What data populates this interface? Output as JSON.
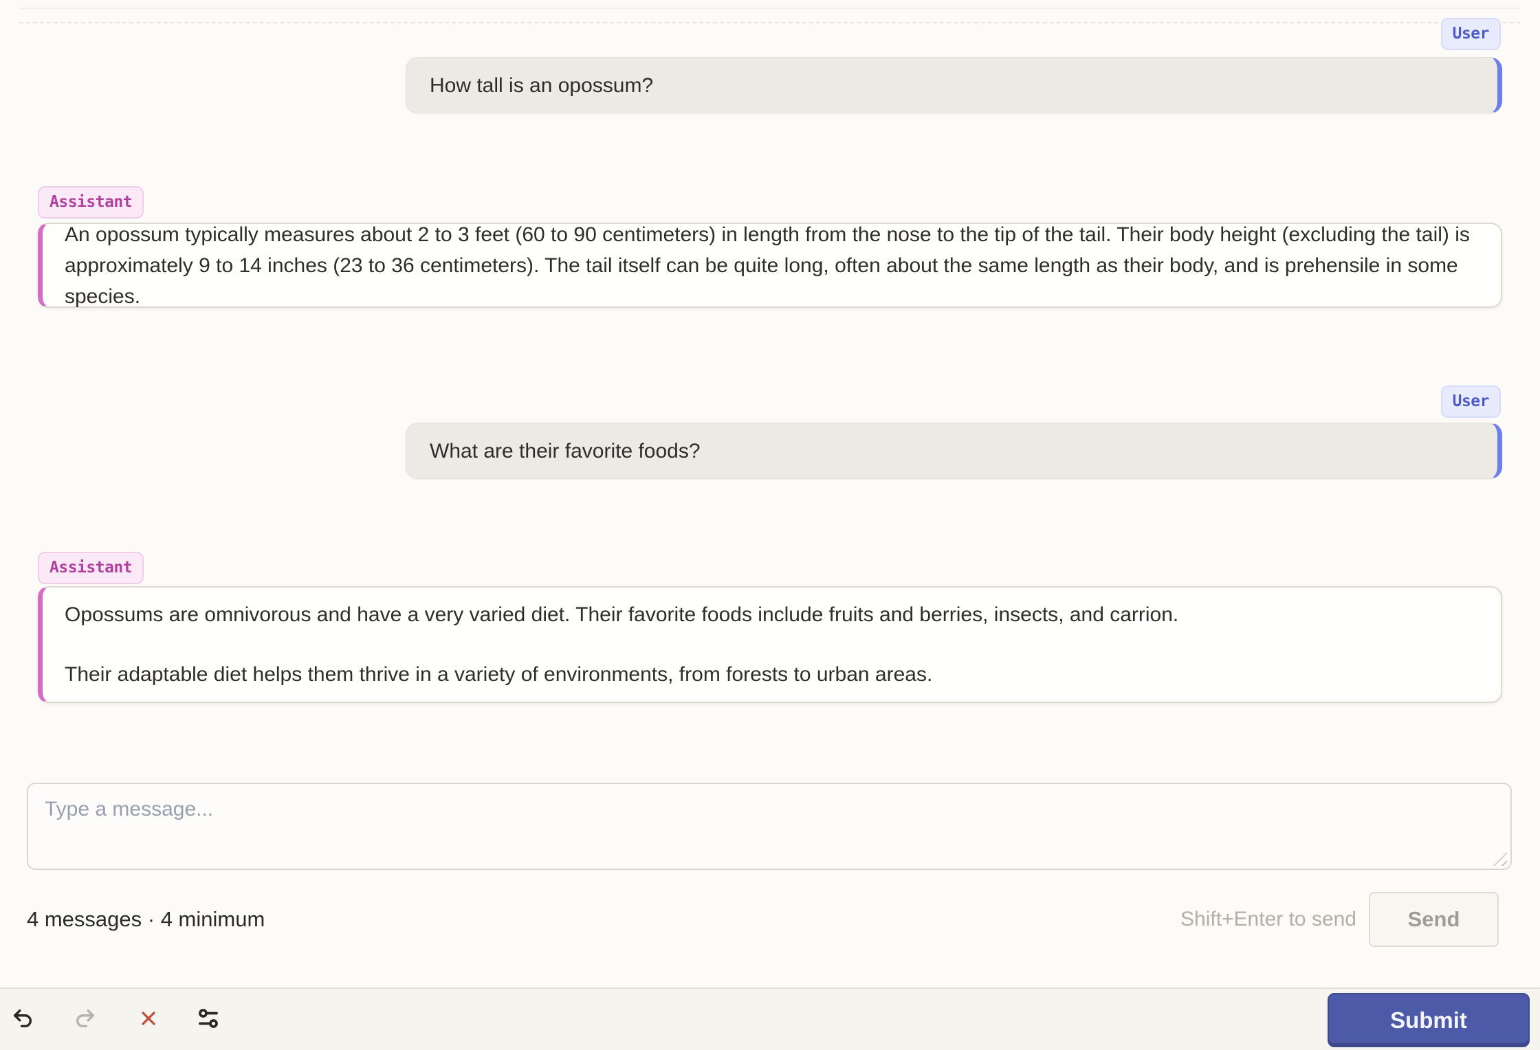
{
  "conversation": {
    "messages": [
      {
        "role_label": "User",
        "paragraphs": [
          "How tall is an opossum?"
        ]
      },
      {
        "role_label": "Assistant",
        "paragraphs": [
          "An opossum typically measures about 2 to 3 feet (60 to 90 centimeters) in length from the nose to the tip of the tail. Their body height (excluding the tail) is approximately 9 to 14 inches (23 to 36 centimeters). The tail itself can be quite long, often about the same length as their body, and is prehensile in some species."
        ]
      },
      {
        "role_label": "User",
        "paragraphs": [
          "What are their favorite foods?"
        ]
      },
      {
        "role_label": "Assistant",
        "paragraphs": [
          "Opossums are omnivorous and have a very varied diet. Their favorite foods include fruits and berries, insects, and carrion.",
          "Their adaptable diet helps them thrive in a variety of environments, from forests to urban areas."
        ]
      }
    ]
  },
  "composer": {
    "placeholder": "Type a message...",
    "value": "",
    "status_text": "4 messages · 4 minimum",
    "send_hint": "Shift+Enter to send",
    "send_label": "Send"
  },
  "toolbar": {
    "icons": [
      "undo-icon",
      "redo-icon",
      "close-icon",
      "sliders-icon"
    ],
    "submit_label": "Submit"
  },
  "colors": {
    "page_bg": "#fcfbf8",
    "user_accent": "#6d7ee9",
    "user_badge_text": "#4c5cc9",
    "user_badge_bg": "#e8ebfc",
    "user_bubble_bg": "#eceae4",
    "assistant_accent": "#d56cc6",
    "assistant_badge_text": "#b0429e",
    "assistant_badge_bg": "#fce9f8",
    "bubble_border": "#dcd9d1",
    "text": "#2f2d29",
    "placeholder": "#98a0b0",
    "hint_text": "#b3afa6",
    "send_disabled_text": "#a19d95",
    "toolbar_bg": "#f5f4ef",
    "submit_bg": "#4d5aa8",
    "close_icon": "#c05140",
    "undo_icon": "#2b2823",
    "redo_icon_disabled": "#b7b3aa"
  }
}
